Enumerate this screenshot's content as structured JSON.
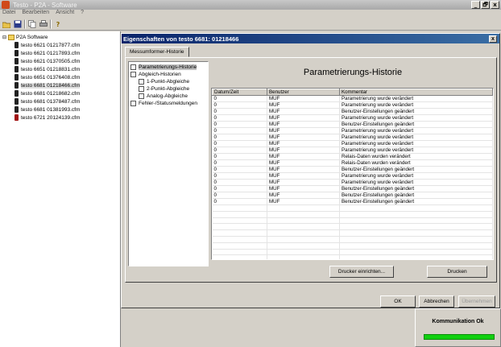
{
  "app": {
    "title": "Testo - P2A - Software",
    "window_controls": [
      "_",
      "🗗",
      "x"
    ]
  },
  "menu": [
    "Datei",
    "Bearbeiten",
    "Ansicht",
    "?"
  ],
  "toolbar": {
    "icons": [
      "folder-open-icon",
      "save-icon",
      "copy-icon",
      "print-icon",
      "help-icon"
    ]
  },
  "tree": {
    "root": "P2A Software",
    "items": [
      {
        "label": "testo 6621  01217877.cfm",
        "color": "dark"
      },
      {
        "label": "testo 6621  01217893.cfm",
        "color": "dark"
      },
      {
        "label": "testo 6621  01370505.cfm",
        "color": "dark"
      },
      {
        "label": "testo 6651  01218831.cfm",
        "color": "dark"
      },
      {
        "label": "testo 6651  01376408.cfm",
        "color": "dark"
      },
      {
        "label": "testo 6681  01218466.cfm",
        "color": "dark",
        "selected": true
      },
      {
        "label": "testo 6681  01218682.cfm",
        "color": "dark"
      },
      {
        "label": "testo 6681  01378487.cfm",
        "color": "dark"
      },
      {
        "label": "testo 6681  01381993.cfm",
        "color": "dark"
      },
      {
        "label": "testo 6721  20124139.cfm",
        "color": "red"
      }
    ]
  },
  "dialog": {
    "title": "Eigenschaften von testo 6681: 01218466",
    "tab": "Messumformer-Historie",
    "nav": [
      {
        "label": "Parametrierungs-Historie",
        "level": 1,
        "selected": true
      },
      {
        "label": "Abgleich-Historien",
        "level": 1
      },
      {
        "label": "1-Punkt-Abgleiche",
        "level": 2
      },
      {
        "label": "2-Punkt-Abgleiche",
        "level": 2
      },
      {
        "label": "Analog-Abgleiche",
        "level": 2
      },
      {
        "label": "Fehler-/Statusmeldungen",
        "level": 1
      }
    ],
    "heading": "Parametrierungs-Historie",
    "columns": [
      "Datum/Zeit",
      "Benutzer",
      "Kommentar"
    ],
    "rows": [
      [
        "0",
        "MUF",
        "Parametrierung wurde verändert"
      ],
      [
        "0",
        "MUF",
        "Parametrierung wurde verändert"
      ],
      [
        "0",
        "MUF",
        "Benutzer-Einstellungen geändert"
      ],
      [
        "0",
        "MUF",
        "Parametrierung wurde verändert"
      ],
      [
        "0",
        "MUF",
        "Benutzer-Einstellungen geändert"
      ],
      [
        "0",
        "MUF",
        "Parametrierung wurde verändert"
      ],
      [
        "0",
        "MUF",
        "Parametrierung wurde verändert"
      ],
      [
        "0",
        "MUF",
        "Parametrierung wurde verändert"
      ],
      [
        "0",
        "MUF",
        "Parametrierung wurde verändert"
      ],
      [
        "0",
        "MUF",
        "Relais-Daten wurden verändert"
      ],
      [
        "0",
        "MUF",
        "Relais-Daten wurden verändert"
      ],
      [
        "0",
        "MUF",
        "Benutzer-Einstellungen geändert"
      ],
      [
        "0",
        "MUF",
        "Parametrierung wurde verändert"
      ],
      [
        "0",
        "MUF",
        "Parametrierung wurde verändert"
      ],
      [
        "0",
        "MUF",
        "Benutzer-Einstellungen geändert"
      ],
      [
        "0",
        "MUF",
        "Benutzer-Einstellungen geändert"
      ],
      [
        "0",
        "MUF",
        "Benutzer-Einstellungen geändert"
      ]
    ],
    "empty_rows": 10,
    "btn_printer_setup": "Drucker einrichten...",
    "btn_print": "Drucken",
    "btn_ok": "OK",
    "btn_cancel": "Abbrechen",
    "btn_apply": "Übernehmen"
  },
  "status": {
    "text": "Kommunikation Ok",
    "color": "#10d010"
  }
}
